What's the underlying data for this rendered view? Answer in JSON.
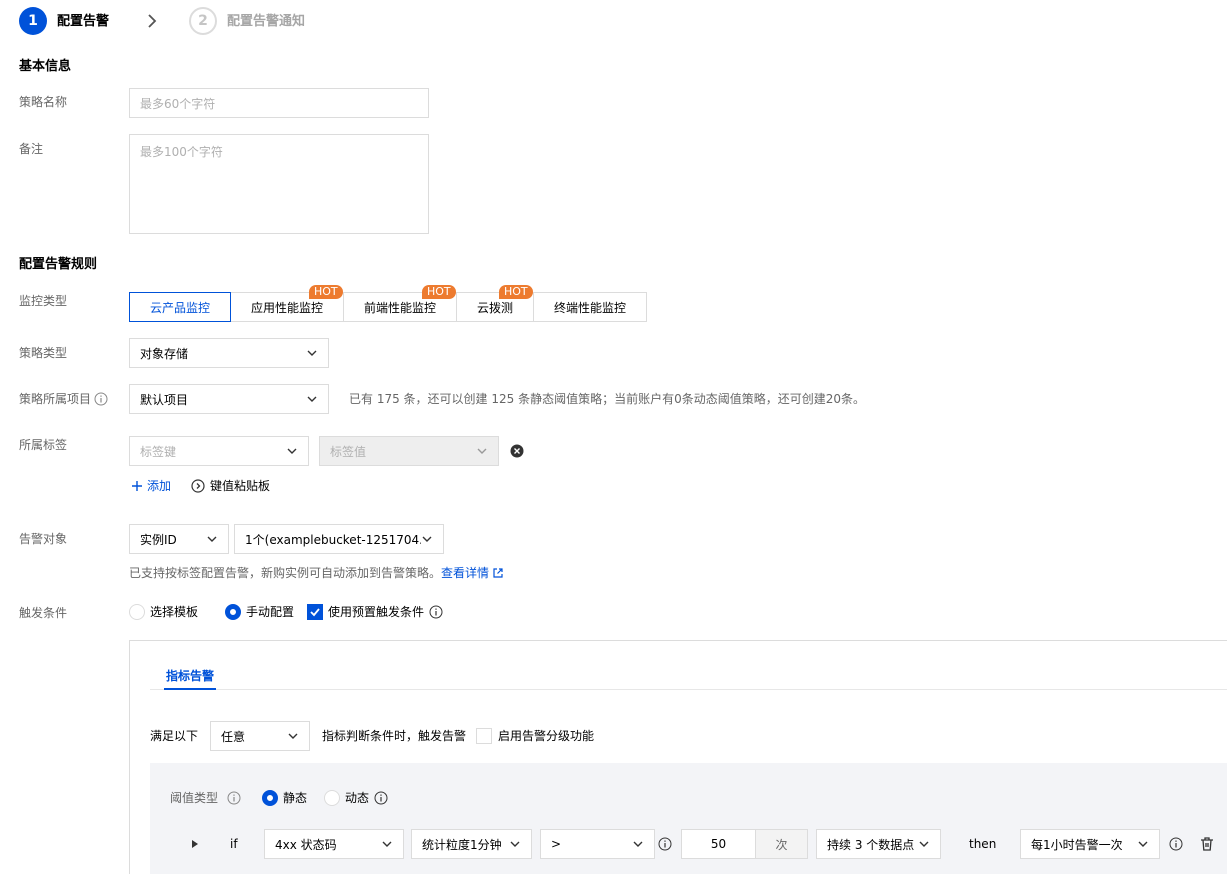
{
  "steps": [
    {
      "number": "1",
      "label": "配置告警"
    },
    {
      "number": "2",
      "label": "配置告警通知"
    }
  ],
  "basic_info": {
    "title": "基本信息",
    "name_label": "策略名称",
    "name_placeholder": "最多60个字符",
    "remark_label": "备注",
    "remark_placeholder": "最多100个字符"
  },
  "rules": {
    "title": "配置告警规则",
    "monitor_type_label": "监控类型",
    "monitor_types": [
      {
        "label": "云产品监控",
        "hot": ""
      },
      {
        "label": "应用性能监控",
        "hot": "HOT"
      },
      {
        "label": "前端性能监控",
        "hot": "HOT"
      },
      {
        "label": "云拨测",
        "hot": "HOT"
      },
      {
        "label": "终端性能监控",
        "hot": ""
      }
    ],
    "policy_type_label": "策略类型",
    "policy_type_value": "对象存储",
    "project_label": "策略所属项目",
    "project_value": "默认项目",
    "project_note": "已有 175 条，还可以创建 125 条静态阈值策略；当前账户有0条动态阈值策略，还可创建20条。",
    "tags_label": "所属标签",
    "tag_key_placeholder": "标签键",
    "tag_value_placeholder": "标签值",
    "add_label": "添加",
    "paste_label": "键值粘贴板",
    "target_label": "告警对象",
    "target_type_value": "实例ID",
    "target_value": "1个(examplebucket-1251704...",
    "target_note": "已支持按标签配置告警，新购实例可自动添加到告警策略。",
    "target_link": "查看详情",
    "trigger_label": "触发条件",
    "trigger_template": "选择模板",
    "trigger_manual": "手动配置",
    "trigger_preset": "使用预置触发条件"
  },
  "metric_panel": {
    "tab_label": "指标告警",
    "satisfy_label": "满足以下",
    "satisfy_value": "任意",
    "satisfy_suffix": "指标判断条件时，触发告警",
    "grading_label": "启用告警分级功能",
    "threshold_label": "阈值类型",
    "static_label": "静态",
    "dynamic_label": "动态",
    "if_label": "if",
    "metric_value": "4xx 状态码",
    "granularity_value": "统计粒度1分钟",
    "operator_value": ">",
    "threshold_value": "50",
    "unit_label": "次",
    "duration_value": "持续 3 个数据点",
    "then_label": "then",
    "frequency_value": "每1小时告警一次"
  },
  "colors": {
    "primary": "#0052d9",
    "hot": "#ed7b2f",
    "border": "#dcdcdc"
  }
}
